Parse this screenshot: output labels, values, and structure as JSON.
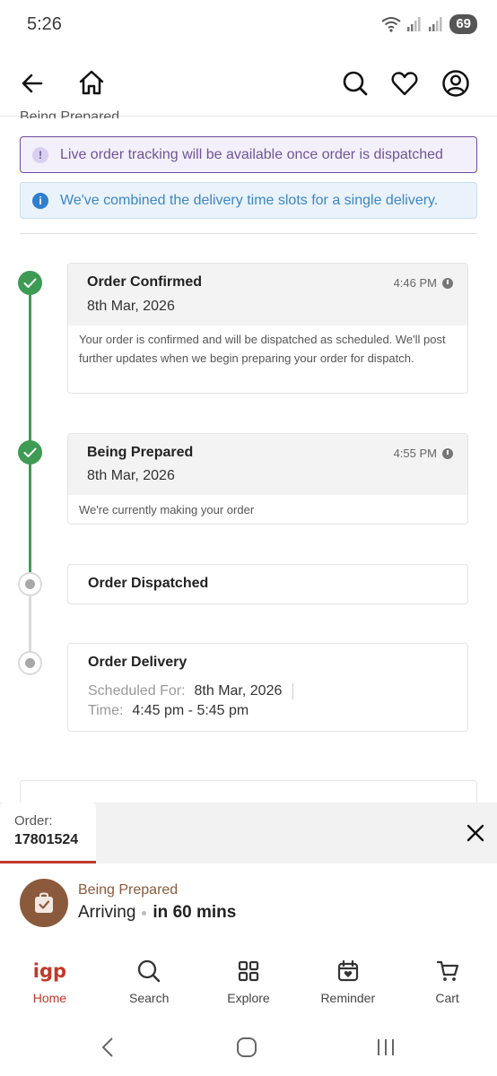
{
  "status_bar": {
    "time": "5:26",
    "battery": "69"
  },
  "previous_heading": "Being Prepared",
  "banners": {
    "live_tracking": "Live order tracking will be available once order is dispatched",
    "combined_slots": "We've combined the delivery time slots for a single delivery."
  },
  "timeline": {
    "confirmed": {
      "title": "Order Confirmed",
      "date": "8th Mar, 2026",
      "time": "4:46 PM",
      "description": "Your order is confirmed and will be dispatched as scheduled. We'll post further updates when we begin preparing your order for dispatch."
    },
    "prepared": {
      "title": "Being Prepared",
      "date": "8th Mar, 2026",
      "time": "4:55 PM",
      "description": "We're currently making your order"
    },
    "dispatched": {
      "title": "Order Dispatched"
    },
    "delivery": {
      "title": "Order Delivery",
      "scheduled_label": "Scheduled For:",
      "scheduled_value": "8th Mar, 2026",
      "time_label": "Time:",
      "time_value": "4:45 pm - 5:45 pm"
    }
  },
  "order_sheet": {
    "order_label": "Order:",
    "order_number": "17801524",
    "status": "Being Prepared",
    "arriving_label": "Arriving",
    "arriving_eta": "in 60 mins"
  },
  "bottom_nav": [
    {
      "label": "Home",
      "icon": "igp-logo"
    },
    {
      "label": "Search",
      "icon": "search-icon"
    },
    {
      "label": "Explore",
      "icon": "grid-icon"
    },
    {
      "label": "Reminder",
      "icon": "calendar-heart-icon"
    },
    {
      "label": "Cart",
      "icon": "cart-icon"
    }
  ],
  "colors": {
    "success": "#3e9b54",
    "brand": "#c0392b",
    "live_banner": "#6e5599",
    "info_banner": "#3e86c4",
    "status_brown": "#8b5a3c"
  }
}
